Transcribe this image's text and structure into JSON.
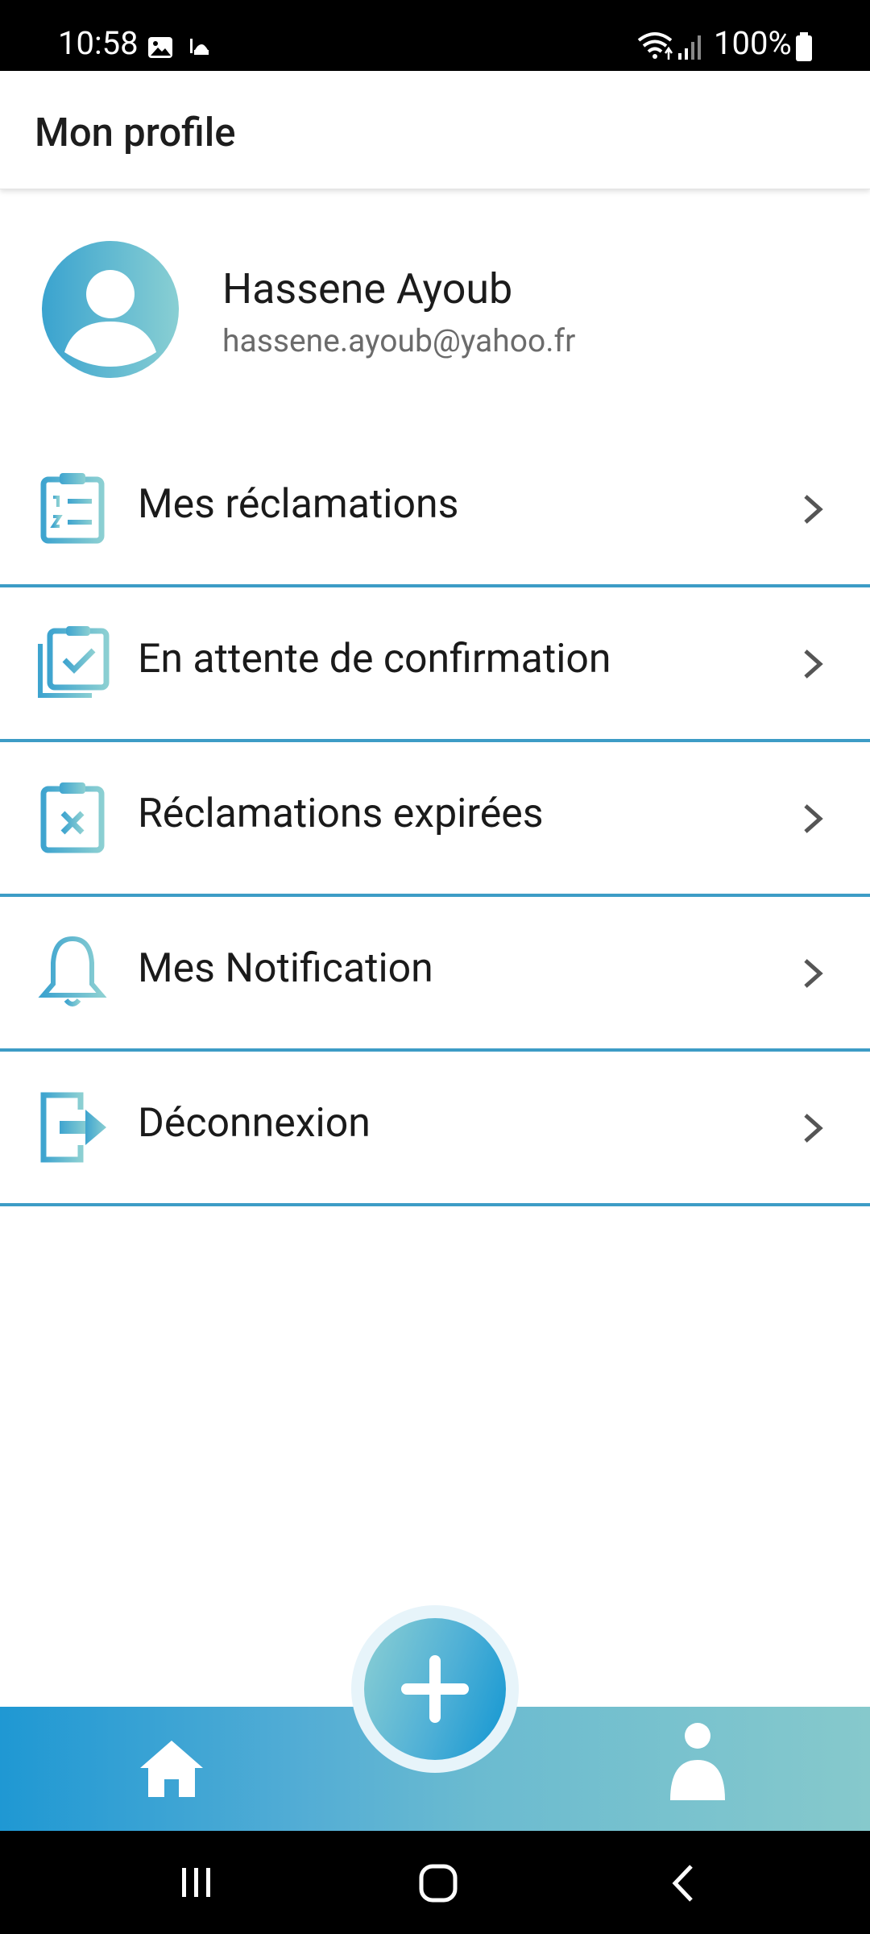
{
  "status_bar": {
    "time": "10:58",
    "battery": "100%",
    "icons": [
      "gallery-icon",
      "mosque-icon",
      "wifi-icon",
      "signal-icon",
      "battery-icon"
    ]
  },
  "app_bar": {
    "title": "Mon profile"
  },
  "profile": {
    "name": "Hassene Ayoub",
    "email": "hassene.ayoub@yahoo.fr",
    "avatar_icon": "user-avatar-icon"
  },
  "menu": {
    "items": [
      {
        "label": "Mes réclamations",
        "icon": "clipboard-list-icon"
      },
      {
        "label": "En attente de confirmation",
        "icon": "clipboard-check-icon"
      },
      {
        "label": "Réclamations expirées",
        "icon": "clipboard-x-icon"
      },
      {
        "label": "Mes Notification",
        "icon": "bell-icon"
      },
      {
        "label": "Déconnexion",
        "icon": "logout-icon"
      }
    ]
  },
  "bottom_nav": {
    "items": [
      "home-icon",
      "add-icon",
      "profile-icon"
    ]
  },
  "colors": {
    "accent_blue": "#1f98d3",
    "accent_teal": "#86c9cc",
    "divider": "#3d9cc6"
  }
}
